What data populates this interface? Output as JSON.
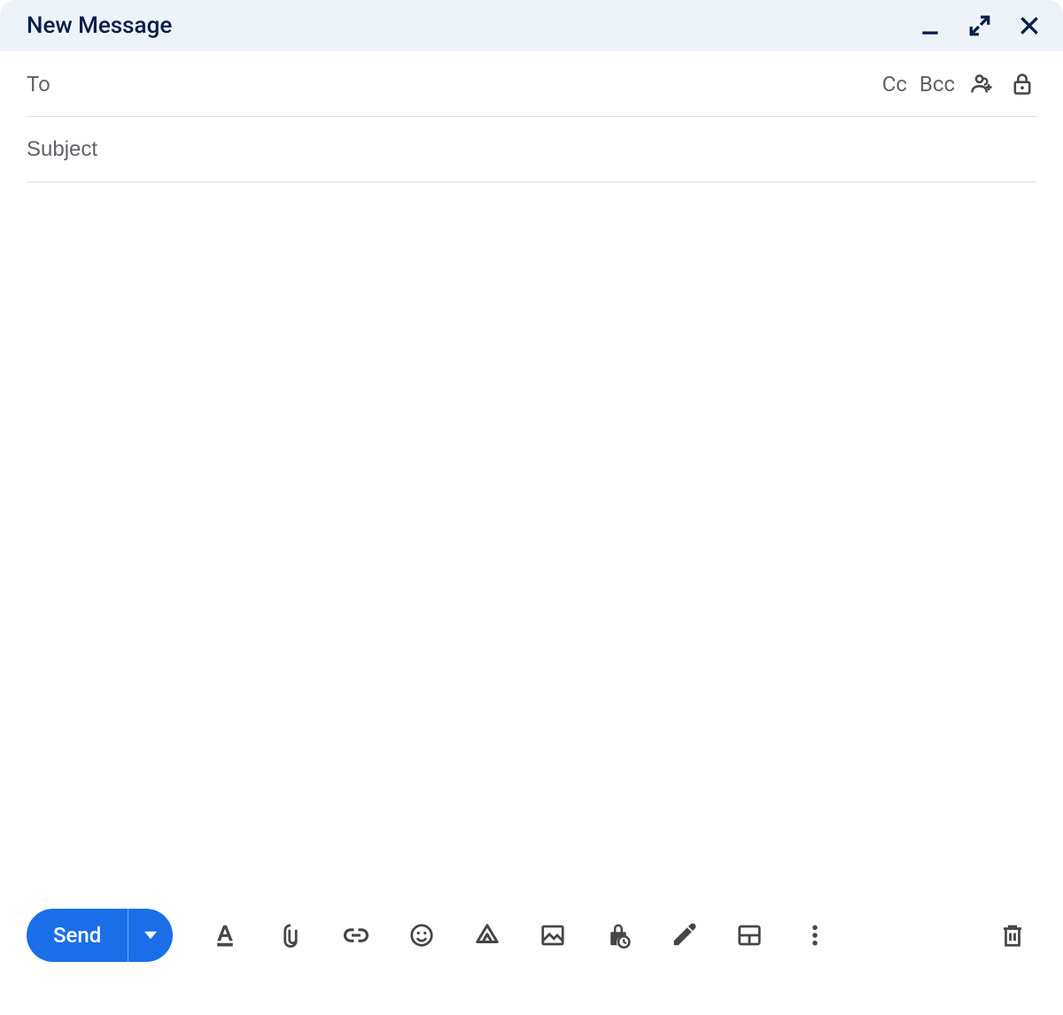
{
  "header": {
    "title": "New Message"
  },
  "fields": {
    "to_label": "To",
    "to_value": "",
    "cc_label": "Cc",
    "bcc_label": "Bcc",
    "subject_placeholder": "Subject",
    "subject_value": "",
    "body_value": ""
  },
  "footer": {
    "send_label": "Send"
  }
}
